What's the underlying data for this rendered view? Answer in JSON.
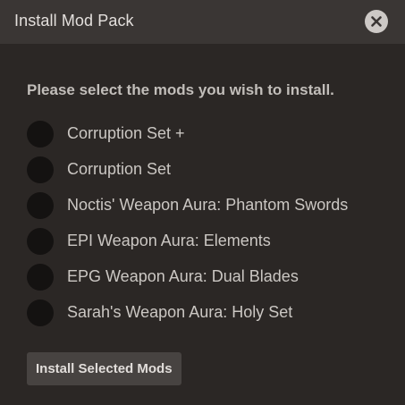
{
  "dialog": {
    "title": "Install Mod Pack",
    "close_icon": "close-icon",
    "prompt": "Please select the mods you wish to install.",
    "mods": [
      {
        "label": "Corruption Set +",
        "selected": false
      },
      {
        "label": "Corruption Set",
        "selected": false
      },
      {
        "label": "Noctis' Weapon Aura: Phantom Swords",
        "selected": false
      },
      {
        "label": "EPI Weapon Aura: Elements",
        "selected": false
      },
      {
        "label": "EPG Weapon Aura: Dual Blades",
        "selected": false
      },
      {
        "label": "Sarah's Weapon Aura: Holy Set",
        "selected": false
      }
    ],
    "install_button_label": "Install Selected Mods"
  },
  "colors": {
    "background": "#2b2725",
    "titlebar": "#3a3634",
    "radio_fill": "#141211",
    "button_bg": "#474341",
    "close_bg": "#cdc9c6"
  }
}
